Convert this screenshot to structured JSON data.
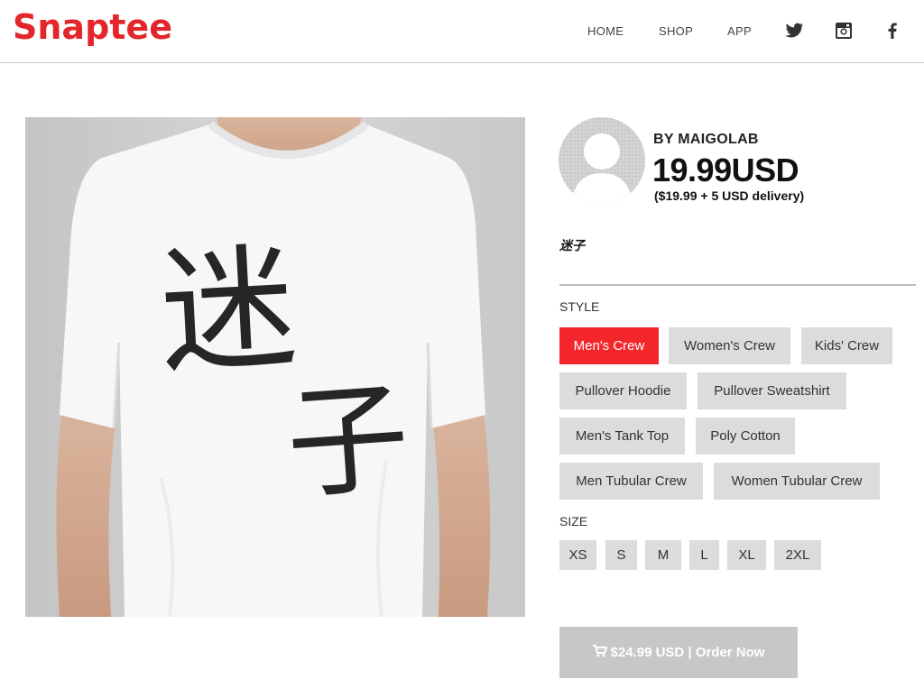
{
  "header": {
    "logo": "Snaptee",
    "nav": {
      "home": "HOME",
      "shop": "SHOP",
      "app": "APP"
    },
    "social": [
      "twitter-icon",
      "instagram-icon",
      "facebook-icon"
    ]
  },
  "product": {
    "image_text": [
      "迷",
      "子"
    ],
    "designer": "BY MAIGOLAB",
    "price": "19.99USD",
    "delivery": "($19.99 + 5 USD delivery)",
    "title": "迷子"
  },
  "style": {
    "label": "STYLE",
    "options": [
      "Men's Crew",
      "Women's Crew",
      "Kids' Crew",
      "Pullover Hoodie",
      "Pullover Sweatshirt",
      "Men's Tank Top",
      "Poly Cotton",
      "Men Tubular Crew",
      "Women Tubular Crew"
    ],
    "selected": "Men's Crew"
  },
  "size": {
    "label": "SIZE",
    "options": [
      "XS",
      "S",
      "M",
      "L",
      "XL",
      "2XL"
    ]
  },
  "order": {
    "label": "$24.99 USD | Order Now"
  },
  "colors": {
    "brand": "#e3262b",
    "selected": "#f3262c",
    "option_bg": "#dcdcdc",
    "order_bg": "#c7c7c7"
  }
}
